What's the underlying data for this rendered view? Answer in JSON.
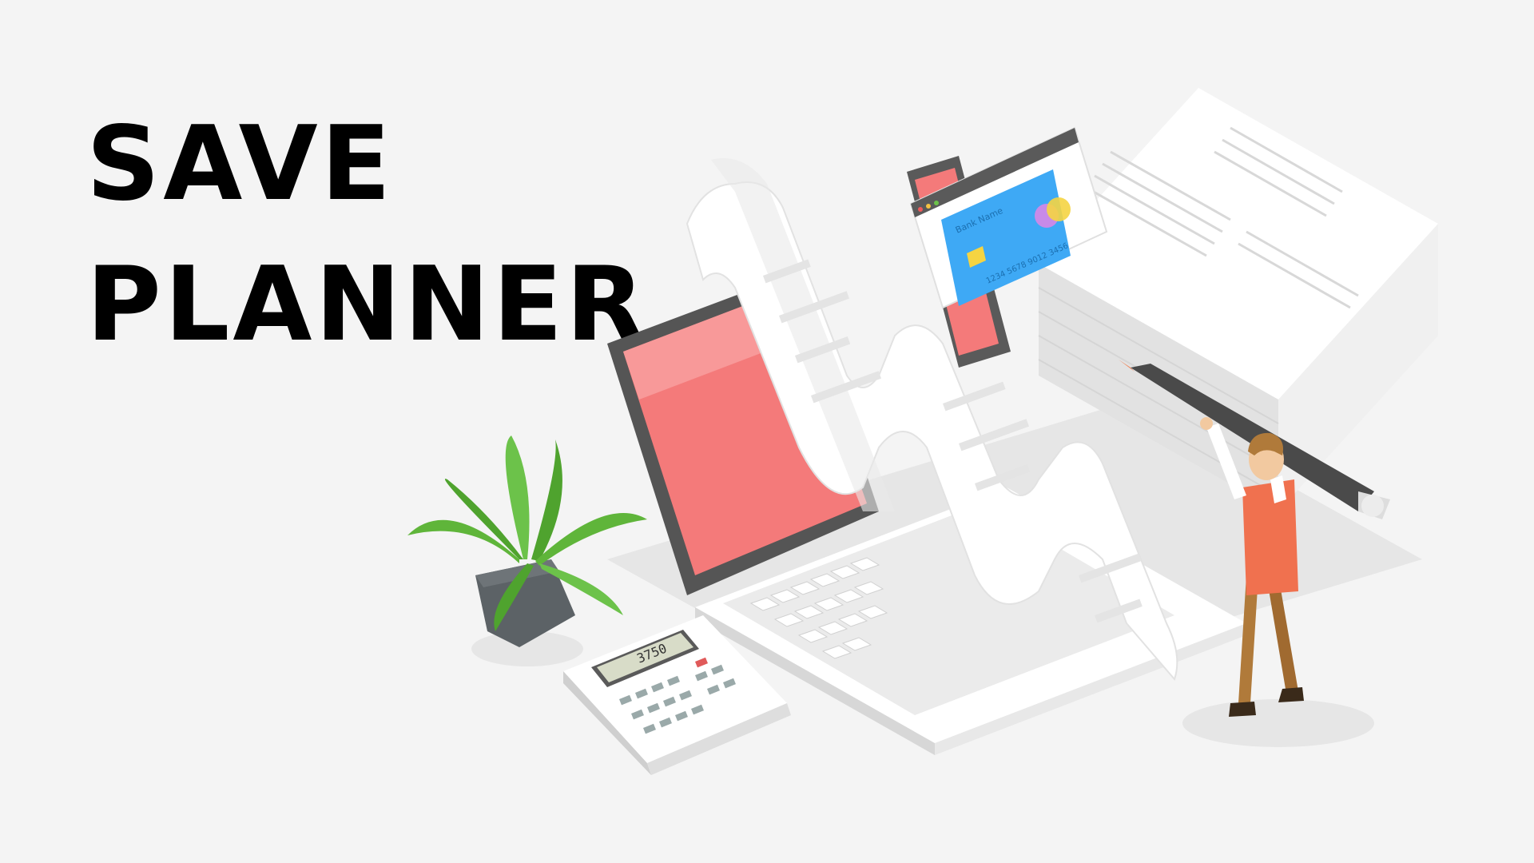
{
  "heading": {
    "line1": "SAVE",
    "line2": "PLANNER"
  },
  "illustration": {
    "card": {
      "bank_name": "Bank Name",
      "number": "1234 5678 9012 3456"
    },
    "calculator_display": "3750",
    "icons": [
      "plant-icon",
      "calculator-icon",
      "laptop-icon",
      "credit-card-icon",
      "receipt-icon",
      "paper-stack-icon",
      "pen-icon",
      "person-icon"
    ],
    "colors": {
      "screen": "#f47a7a",
      "card": "#3ea9f5",
      "shirt": "#f0714f",
      "plant": "#5fb53a",
      "background": "#f4f4f4"
    }
  }
}
